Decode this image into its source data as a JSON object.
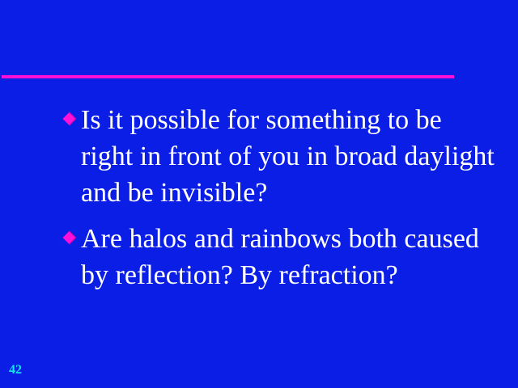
{
  "slide": {
    "bullets": [
      {
        "icon": "diamond-bullet-icon",
        "text": "Is it possible for something to be right in front of you in broad daylight and be invisible?"
      },
      {
        "icon": "diamond-bullet-icon",
        "text": "Are halos and rainbows both caused by reflection? By refraction?"
      }
    ],
    "page_number": "42"
  },
  "colors": {
    "background": "#0b1ee6",
    "accent": "#ff10d8",
    "text": "#ffffff",
    "page_number": "#14e6e6"
  }
}
